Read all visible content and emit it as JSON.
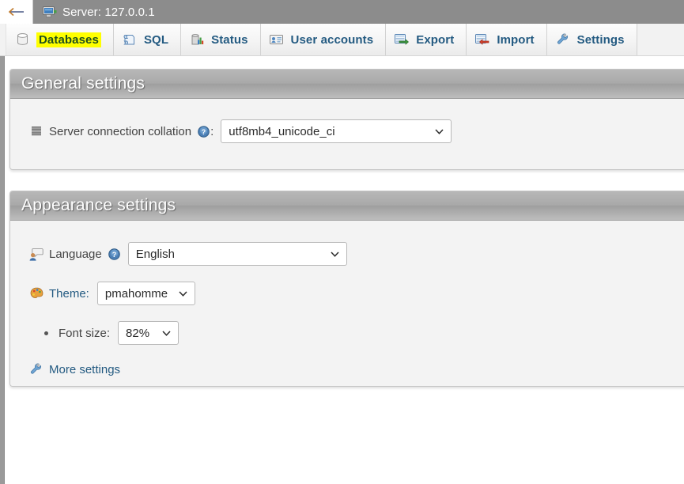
{
  "titlebar": {
    "back_label": "back-arrow",
    "server_icon": "server-icon",
    "title": "Server: 127.0.0.1"
  },
  "tabs": [
    {
      "id": "databases",
      "label": "Databases",
      "icon": "database-icon",
      "highlighted": true
    },
    {
      "id": "sql",
      "label": "SQL",
      "icon": "sql-scroll-icon",
      "highlighted": false
    },
    {
      "id": "status",
      "label": "Status",
      "icon": "status-chart-icon",
      "highlighted": false
    },
    {
      "id": "user-accounts",
      "label": "User accounts",
      "icon": "user-card-icon",
      "highlighted": false
    },
    {
      "id": "export",
      "label": "Export",
      "icon": "export-icon",
      "highlighted": false
    },
    {
      "id": "import",
      "label": "Import",
      "icon": "import-icon",
      "highlighted": false
    },
    {
      "id": "settings",
      "label": "Settings",
      "icon": "wrench-icon",
      "highlighted": false
    }
  ],
  "general_settings": {
    "title": "General settings",
    "collation": {
      "icon": "collation-lines-icon",
      "label": "Server connection collation",
      "help_icon": "help-question-icon",
      "colon": ":",
      "value": "utf8mb4_unicode_ci"
    }
  },
  "appearance_settings": {
    "title": "Appearance settings",
    "language": {
      "icon": "language-speech-icon",
      "label": "Language",
      "help_icon": "help-question-icon",
      "value": "English"
    },
    "theme": {
      "icon": "palette-icon",
      "label": "Theme:",
      "value": "pmahomme"
    },
    "font_size": {
      "icon": "bullet-icon",
      "label": "Font size:",
      "value": "82%"
    },
    "more_settings": {
      "icon": "wrench-icon",
      "label": "More settings"
    }
  },
  "colors": {
    "titlebar_bg": "#8c8c8c",
    "tab_label": "#235a81",
    "highlight": "#ffff00",
    "panel_header_bg": "#a9a9a9",
    "panel_body_bg": "#f3f3f3",
    "link": "#235a81"
  }
}
